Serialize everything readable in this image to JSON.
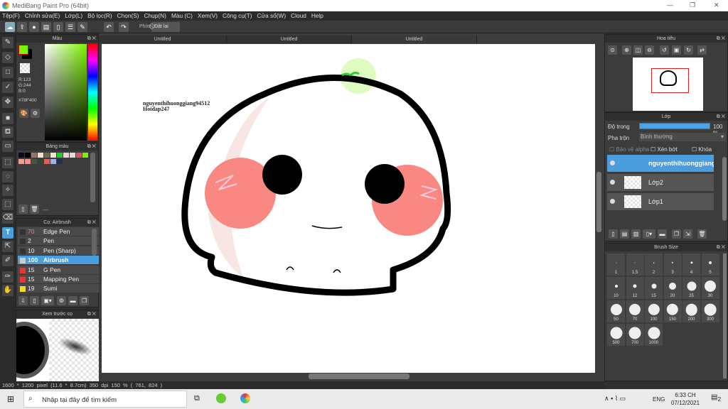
{
  "app": {
    "title": "MediBang Paint Pro (64bit)"
  },
  "menu": [
    "Tệp(F)",
    "Chỉnh sửa(E)",
    "Lớp(L)",
    "Bộ lọc(R)",
    "Chọn(S)",
    "Chụp(N)",
    "Màu (C)",
    "Xem(V)",
    "Công cụ(T)",
    "Cửa sổ(W)",
    "Cloud",
    "Help"
  ],
  "toolbar": {
    "shortcut_label": "Phím",
    "reset_label": "Đặt lại"
  },
  "color_panel": {
    "title": "Màu",
    "r": "R:123",
    "g": "G:244",
    "b": "B:0",
    "hex": "#78F400",
    "fg": "#7bf400",
    "bg": "#000000"
  },
  "palette_panel": {
    "title": "Bảng màu",
    "swatches": [
      "#0a0a1a",
      "#000000",
      "#a07070",
      "#f8e0d0",
      "#607050",
      "#f8e0d8",
      "#22cc22",
      "#f0d0d8",
      "#e8d8d8",
      "#e05060",
      "#7bf400",
      "#f0a090",
      "#f09090",
      "#405840",
      "#304830",
      "#e06060",
      "#a0b0e0",
      "#203050"
    ],
    "footer": "---"
  },
  "brush_panel": {
    "title": "Cọ: Airbrush",
    "brushes": [
      {
        "size": "70",
        "name": "Edge Pen",
        "color": "#333333"
      },
      {
        "size": "2",
        "name": "Pen",
        "color": "#333333"
      },
      {
        "size": "10",
        "name": "Pen (Sharp)",
        "color": "#333333"
      },
      {
        "size": "100",
        "name": "Airbrush",
        "color": "#cccccc",
        "selected": true
      },
      {
        "size": "15",
        "name": "G Pen",
        "color": "#ee3333"
      },
      {
        "size": "15",
        "name": "Mapping Pen",
        "color": "#ee3333"
      },
      {
        "size": "19",
        "name": "Sumi",
        "color": "#eedd22"
      }
    ]
  },
  "preview_panel": {
    "title": "Xem trước cọ"
  },
  "tabs": [
    "Untitled",
    "Untitled",
    "Untitled"
  ],
  "canvas": {
    "text_line1": "nguyenthihuonggiang94512",
    "text_line2": "Hoidap247"
  },
  "navigator": {
    "title": "Hoa tiêu"
  },
  "layer_panel": {
    "title": "Lớp",
    "opacity_label": "Độ trong",
    "opacity_value": "100 %",
    "opacity": 100,
    "blend_label": "Pha trộn",
    "blend_value": "Bình thường",
    "protect_alpha": "Bảo vệ alpha",
    "clipping": "Xén bớt",
    "lock": "Khóa",
    "layers": [
      {
        "name": "nguyenthihuonggiang",
        "selected": true
      },
      {
        "name": "Lớp2"
      },
      {
        "name": "Lớp1"
      }
    ]
  },
  "brush_size_panel": {
    "title": "Brush Size",
    "sizes": [
      "1",
      "1.5",
      "2",
      "3",
      "4",
      "5",
      "10",
      "12",
      "15",
      "20",
      "25",
      "30",
      "50",
      "70",
      "100",
      "150",
      "200",
      "300",
      "500",
      "700",
      "1000"
    ]
  },
  "status": {
    "size": "1600 * 1200 pixel",
    "cm": "(11.6 * 8.7cm)",
    "dpi": "350 dpi",
    "zoom": "150 %",
    "coords": "( 761, 824 )"
  },
  "taskbar": {
    "search_placeholder": "Nhập tại đây để tìm kiếm",
    "lang": "ENG",
    "time": "6:33 CH",
    "date": "07/12/2021",
    "notif": "2"
  }
}
